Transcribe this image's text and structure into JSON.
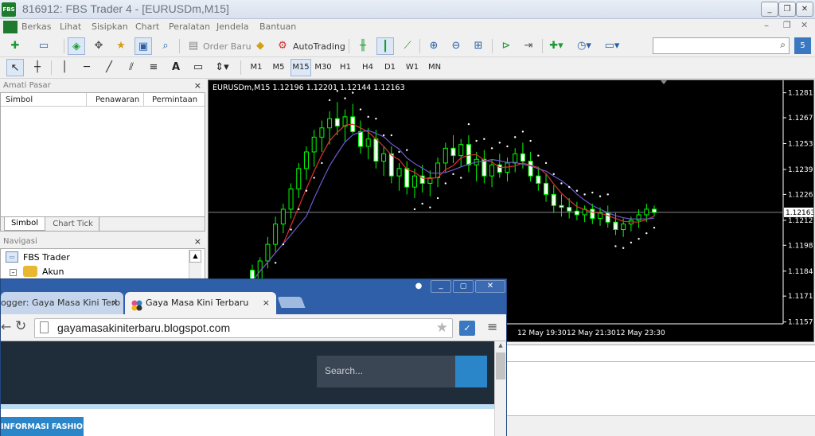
{
  "window": {
    "title": "816912: FBS Trader 4 - [EURUSDm,M15]",
    "logo_text": "FBS"
  },
  "menu": [
    "Berkas",
    "Lihat",
    "Sisipkan",
    "Chart",
    "Peralatan",
    "Jendela",
    "Bantuan"
  ],
  "toolbar": {
    "order_label": "Order Baru",
    "autotrading_label": "AutoTrading",
    "timeframes": [
      "M1",
      "M5",
      "M15",
      "M30",
      "H1",
      "H4",
      "D1",
      "W1",
      "MN"
    ],
    "active_timeframe": "M15",
    "text_tool": "A"
  },
  "market_watch": {
    "title": "Amati Pasar",
    "columns": [
      "Simbol",
      "Penawaran",
      "Permintaan"
    ],
    "tabs": [
      "Simbol",
      "Chart Tick"
    ]
  },
  "navigator": {
    "title": "Navigasi",
    "items": [
      "FBS Trader",
      "Akun"
    ]
  },
  "chart": {
    "header": "EURUSDm,M15  1.12196 1.12201 1.12144 1.12163",
    "current_price": "1.12163"
  },
  "chart_data": {
    "type": "candlestick",
    "symbol": "EURUSDm",
    "timeframe": "M15",
    "ohlc_header": [
      1.12196,
      1.12201,
      1.12144,
      1.12163
    ],
    "y_ticks": [
      1.1281,
      1.12675,
      1.12535,
      1.12395,
      1.1226,
      1.1212,
      1.11985,
      1.11845,
      1.1171,
      1.1157
    ],
    "ylim": [
      1.1156,
      1.1286
    ],
    "x_ticks": [
      "12 May 19:30",
      "12 May 21:30",
      "12 May 23:30"
    ],
    "current_price": 1.12163,
    "candles": [
      [
        1.1185,
        1.1188,
        1.1176,
        1.1179
      ],
      [
        1.1179,
        1.1192,
        1.1177,
        1.119
      ],
      [
        1.119,
        1.1203,
        1.1186,
        1.1199
      ],
      [
        1.1199,
        1.1214,
        1.1195,
        1.121
      ],
      [
        1.121,
        1.1221,
        1.1205,
        1.1218
      ],
      [
        1.1218,
        1.1232,
        1.1213,
        1.1229
      ],
      [
        1.1229,
        1.1243,
        1.1224,
        1.124
      ],
      [
        1.124,
        1.1252,
        1.1234,
        1.1249
      ],
      [
        1.1249,
        1.1261,
        1.1241,
        1.1257
      ],
      [
        1.1257,
        1.1266,
        1.1249,
        1.1262
      ],
      [
        1.1262,
        1.1271,
        1.1253,
        1.1267
      ],
      [
        1.1267,
        1.1276,
        1.1258,
        1.1263
      ],
      [
        1.1263,
        1.1272,
        1.1254,
        1.1268
      ],
      [
        1.1268,
        1.1275,
        1.1259,
        1.126
      ],
      [
        1.126,
        1.1266,
        1.1248,
        1.1252
      ],
      [
        1.1252,
        1.1262,
        1.1245,
        1.1256
      ],
      [
        1.1256,
        1.1261,
        1.124,
        1.1244
      ],
      [
        1.1244,
        1.1252,
        1.1236,
        1.1248
      ],
      [
        1.1248,
        1.1252,
        1.1232,
        1.1236
      ],
      [
        1.1236,
        1.1243,
        1.1228,
        1.124
      ],
      [
        1.124,
        1.1244,
        1.1226,
        1.123
      ],
      [
        1.123,
        1.124,
        1.1224,
        1.1236
      ],
      [
        1.1236,
        1.1242,
        1.1227,
        1.1232
      ],
      [
        1.1232,
        1.1239,
        1.1225,
        1.1235
      ],
      [
        1.1235,
        1.1246,
        1.123,
        1.1243
      ],
      [
        1.1243,
        1.1254,
        1.1238,
        1.1251
      ],
      [
        1.1251,
        1.1258,
        1.1243,
        1.1247
      ],
      [
        1.1247,
        1.1256,
        1.1241,
        1.1253
      ],
      [
        1.1253,
        1.1258,
        1.1238,
        1.1242
      ],
      [
        1.1242,
        1.1249,
        1.1233,
        1.1245
      ],
      [
        1.1245,
        1.125,
        1.1232,
        1.1236
      ],
      [
        1.1236,
        1.1245,
        1.123,
        1.1242
      ],
      [
        1.1242,
        1.1248,
        1.1235,
        1.1238
      ],
      [
        1.1238,
        1.1246,
        1.1233,
        1.1243
      ],
      [
        1.1243,
        1.1251,
        1.1238,
        1.1248
      ],
      [
        1.1248,
        1.1254,
        1.124,
        1.1244
      ],
      [
        1.1244,
        1.1249,
        1.1233,
        1.1236
      ],
      [
        1.1236,
        1.1241,
        1.1228,
        1.1232
      ],
      [
        1.1232,
        1.1237,
        1.1222,
        1.1226
      ],
      [
        1.1226,
        1.1231,
        1.1216,
        1.122
      ],
      [
        1.122,
        1.1226,
        1.1214,
        1.1219
      ],
      [
        1.1219,
        1.1224,
        1.1213,
        1.1217
      ],
      [
        1.1217,
        1.1222,
        1.1212,
        1.1215
      ],
      [
        1.1215,
        1.122,
        1.1211,
        1.1218
      ],
      [
        1.1218,
        1.1221,
        1.121,
        1.1213
      ],
      [
        1.1213,
        1.1219,
        1.1209,
        1.1216
      ],
      [
        1.1216,
        1.122,
        1.1208,
        1.1211
      ],
      [
        1.1211,
        1.1216,
        1.1204,
        1.1207
      ],
      [
        1.1207,
        1.1213,
        1.1203,
        1.121
      ],
      [
        1.121,
        1.1214,
        1.1206,
        1.1212
      ],
      [
        1.1212,
        1.1218,
        1.1208,
        1.1215
      ],
      [
        1.1215,
        1.1221,
        1.1211,
        1.1218
      ],
      [
        1.1218,
        1.122,
        1.1214,
        1.12163
      ]
    ]
  },
  "browser": {
    "tabs": [
      {
        "title": "ogger: Gaya Masa Kini Terb",
        "close": "×"
      },
      {
        "title": "Gaya Masa Kini Terbaru",
        "close": "×"
      }
    ],
    "url": "gayamasakiniterbaru.blogspot.com",
    "search_placeholder": "Search...",
    "nav_label": "INFORMASI FASHION"
  },
  "colors": {
    "bull_candle": "#00ff00",
    "bear_candle": "#00ff00",
    "ma_fast": "#e03030",
    "ma_slow": "#6a5acd",
    "sar": "#ffffff",
    "nav_label_bg": "#2a86c8"
  }
}
